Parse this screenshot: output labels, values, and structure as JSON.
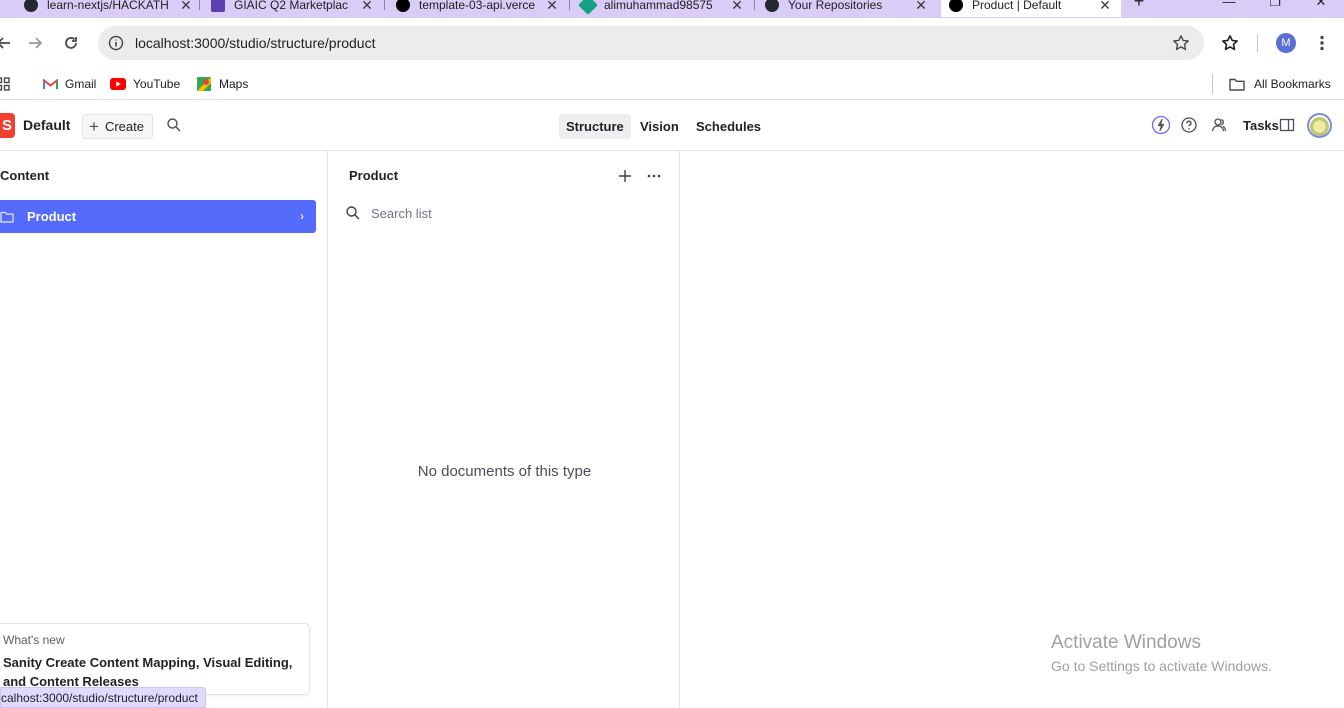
{
  "browser": {
    "tabs": [
      {
        "title": "learn-nextjs/HACKATH",
        "color": "#24292f"
      },
      {
        "title": "GIAIC Q2 Marketplac",
        "color": "#5b3fb4"
      },
      {
        "title": "template-03-api.verce",
        "color": "#000000"
      },
      {
        "title": "alimuhammad98575",
        "color": "#16a085"
      },
      {
        "title": "Your Repositories",
        "color": "#24292f"
      },
      {
        "title": "Product | Default",
        "color": "#000000"
      }
    ],
    "new_tab": "+",
    "url": "localhost:3000/studio/structure/product",
    "profile_initial": "M",
    "bookmarks": [
      {
        "label": "Gmail",
        "icon": "gmail-icon"
      },
      {
        "label": "YouTube",
        "icon": "youtube-icon"
      },
      {
        "label": "Maps",
        "icon": "maps-icon"
      }
    ],
    "all_bookmarks": "All Bookmarks",
    "status_url": "calhost:3000/studio/structure/product"
  },
  "studio": {
    "logo_letter": "S",
    "workspace": "Default",
    "create_label": "Create",
    "tools": [
      "Structure",
      "Vision",
      "Schedules"
    ],
    "selected_tool": "Structure",
    "tasks_label": "Tasks",
    "accent": "#556bfc"
  },
  "content_pane": {
    "title": "Content",
    "items": [
      {
        "label": "Product",
        "selected": true
      }
    ]
  },
  "product_pane": {
    "title": "Product",
    "search_placeholder": "Search list",
    "empty_message": "No documents of this type"
  },
  "whats_new": {
    "label": "What's new",
    "title": "Sanity Create Content Mapping, Visual Editing, and Content Releases"
  },
  "watermark": {
    "line1": "Activate Windows",
    "line2": "Go to Settings to activate Windows."
  }
}
